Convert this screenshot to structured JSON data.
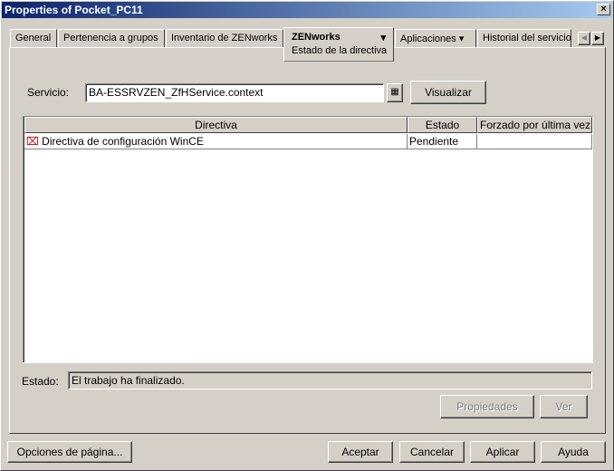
{
  "window": {
    "title": "Properties of Pocket_PC11",
    "close": "×"
  },
  "tabs": [
    {
      "label": "General"
    },
    {
      "label": "Pertenencia a grupos"
    },
    {
      "label": "Inventario de ZENworks"
    },
    {
      "label": "ZENworks",
      "sub": "Estado de la directiva"
    },
    {
      "label": "Aplicaciones"
    },
    {
      "label": "Historial del servicio"
    }
  ],
  "service": {
    "label": "Servicio:",
    "value": "BA-ESSRVZEN_ZfHService.context",
    "view_button": "Visualizar"
  },
  "table": {
    "columns": [
      "Directiva",
      "Estado",
      "Forzado por última vez"
    ],
    "rows": [
      {
        "directiva": "Directiva de configuración WinCE",
        "estado": "Pendiente",
        "forzado": ""
      }
    ]
  },
  "status": {
    "label": "Estado:",
    "value": "El trabajo ha finalizado."
  },
  "buttons": {
    "properties": "Propiedades",
    "view": "Ver",
    "page_options": "Opciones de página...",
    "accept": "Aceptar",
    "cancel": "Cancelar",
    "apply": "Aplicar",
    "help": "Ayuda"
  }
}
